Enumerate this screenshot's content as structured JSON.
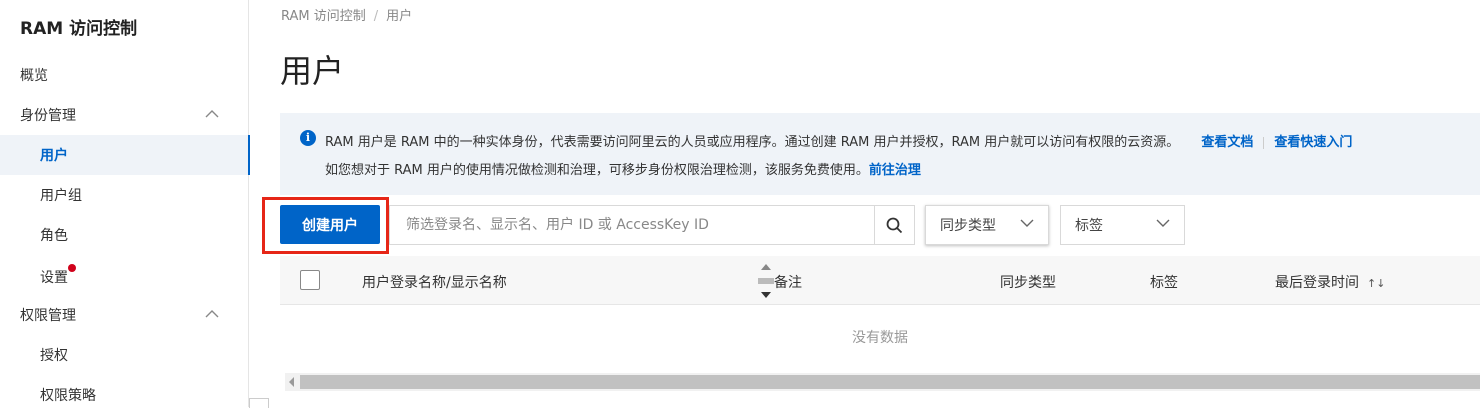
{
  "sidebar": {
    "title": "RAM 访问控制",
    "items": [
      {
        "label": "概览"
      },
      {
        "label": "身份管理"
      },
      {
        "label": "用户"
      },
      {
        "label": "用户组"
      },
      {
        "label": "角色"
      },
      {
        "label": "设置"
      },
      {
        "label": "权限管理"
      },
      {
        "label": "授权"
      },
      {
        "label": "权限策略"
      }
    ]
  },
  "breadcrumb": {
    "root": "RAM 访问控制",
    "sep": "/",
    "current": "用户"
  },
  "page_title": "用户",
  "notice": {
    "line1": "RAM 用户是 RAM 中的一种实体身份，代表需要访问阿里云的人员或应用程序。通过创建 RAM 用户并授权，RAM 用户就可以访问有权限的云资源。",
    "link_docs": "查看文档",
    "link_quick": "查看快速入门",
    "line2": "如您想对于 RAM 用户的使用情况做检测和治理，可移步身份权限治理检测，该服务免费使用。",
    "link_govern": "前往治理"
  },
  "toolbar": {
    "create_label": "创建用户",
    "search_placeholder": "筛选登录名、显示名、用户 ID 或 AccessKey ID",
    "sync_type": "同步类型",
    "tag": "标签"
  },
  "table": {
    "columns": [
      "用户登录名称/显示名称",
      "备注",
      "同步类型",
      "标签",
      "最后登录时间"
    ],
    "sort_glyph": "↑↓",
    "empty_text": "没有数据"
  },
  "colors": {
    "primary": "#0064c8",
    "highlight": "#e62617",
    "notice_bg": "#eff3f8"
  }
}
